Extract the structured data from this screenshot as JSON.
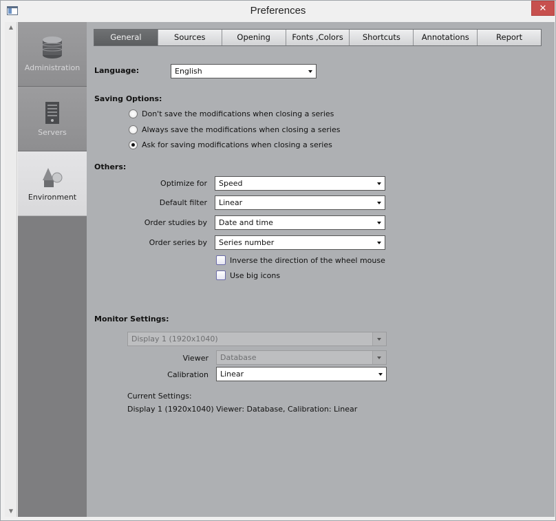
{
  "window": {
    "title": "Preferences"
  },
  "sidebar": {
    "items": [
      {
        "label": "Administration",
        "icon": "database-icon"
      },
      {
        "label": "Servers",
        "icon": "server-icon"
      },
      {
        "label": "Environment",
        "icon": "shapes-icon"
      }
    ]
  },
  "tabs": [
    "General",
    "Sources",
    "Opening",
    "Fonts ,Colors",
    "Shortcuts",
    "Annotations",
    "Report"
  ],
  "general": {
    "language_label": "Language:",
    "language_value": "English",
    "saving_title": "Saving Options:",
    "saving_options": [
      "Don't save the modifications when closing a series",
      "Always save the modifications when closing a series",
      "Ask for saving modifications when closing a series"
    ],
    "others_title": "Others:",
    "optimize_label": "Optimize for",
    "optimize_value": "Speed",
    "filter_label": "Default filter",
    "filter_value": "Linear",
    "order_studies_label": "Order studies by",
    "order_studies_value": "Date and time",
    "order_series_label": "Order series by",
    "order_series_value": "Series number",
    "check_wheel": "Inverse the direction of the wheel mouse",
    "check_big_icons": "Use big icons",
    "monitor_title": "Monitor Settings:",
    "display_value": "Display 1 (1920x1040)",
    "viewer_label": "Viewer",
    "viewer_value": "Database",
    "calibration_label": "Calibration",
    "calibration_value": "Linear",
    "current_label": "Current Settings:",
    "current_value": "Display 1 (1920x1040) Viewer: Database, Calibration: Linear"
  }
}
